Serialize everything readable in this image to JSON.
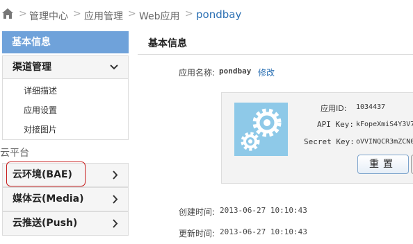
{
  "breadcrumb": {
    "items": [
      "管理中心",
      "应用管理",
      "Web应用"
    ],
    "current": "pondbay",
    "separator": ">"
  },
  "sidebar": {
    "active_item": "基本信息",
    "section": {
      "label": "渠道管理",
      "icon": "chevron-down-icon"
    },
    "sub_items": [
      "详细描述",
      "应用设置",
      "对接图片"
    ],
    "cloud_title": "云平台",
    "cloud_items": [
      {
        "label": "云环境(BAE)",
        "icon": "chevron-right-icon"
      },
      {
        "label": "媒体云(Media)",
        "icon": "chevron-right-icon"
      },
      {
        "label": "云推送(Push)",
        "icon": "chevron-right-icon"
      }
    ],
    "highlight_color": "#c81e1e",
    "active_color": "#6fa2da"
  },
  "main": {
    "title": "基本信息",
    "app_name_label": "应用名称:",
    "app_name_value": "pondbay",
    "edit_link": "修改",
    "card": {
      "icon": "gears-icon",
      "app_id_label": "应用ID:",
      "app_id_value": "1034437",
      "api_key_label": "API Key:",
      "api_key_value": "kFopeXmiS4Y3V7",
      "secret_key_label": "Secret Key:",
      "secret_key_value": "oVVINQCR3mZCN0",
      "reset_button": "重置"
    },
    "created_label": "创建时间:",
    "created_value": "2013-06-27 10:10:43",
    "updated_label": "更新时间:",
    "updated_value": "2013-06-27 10:10:43"
  }
}
